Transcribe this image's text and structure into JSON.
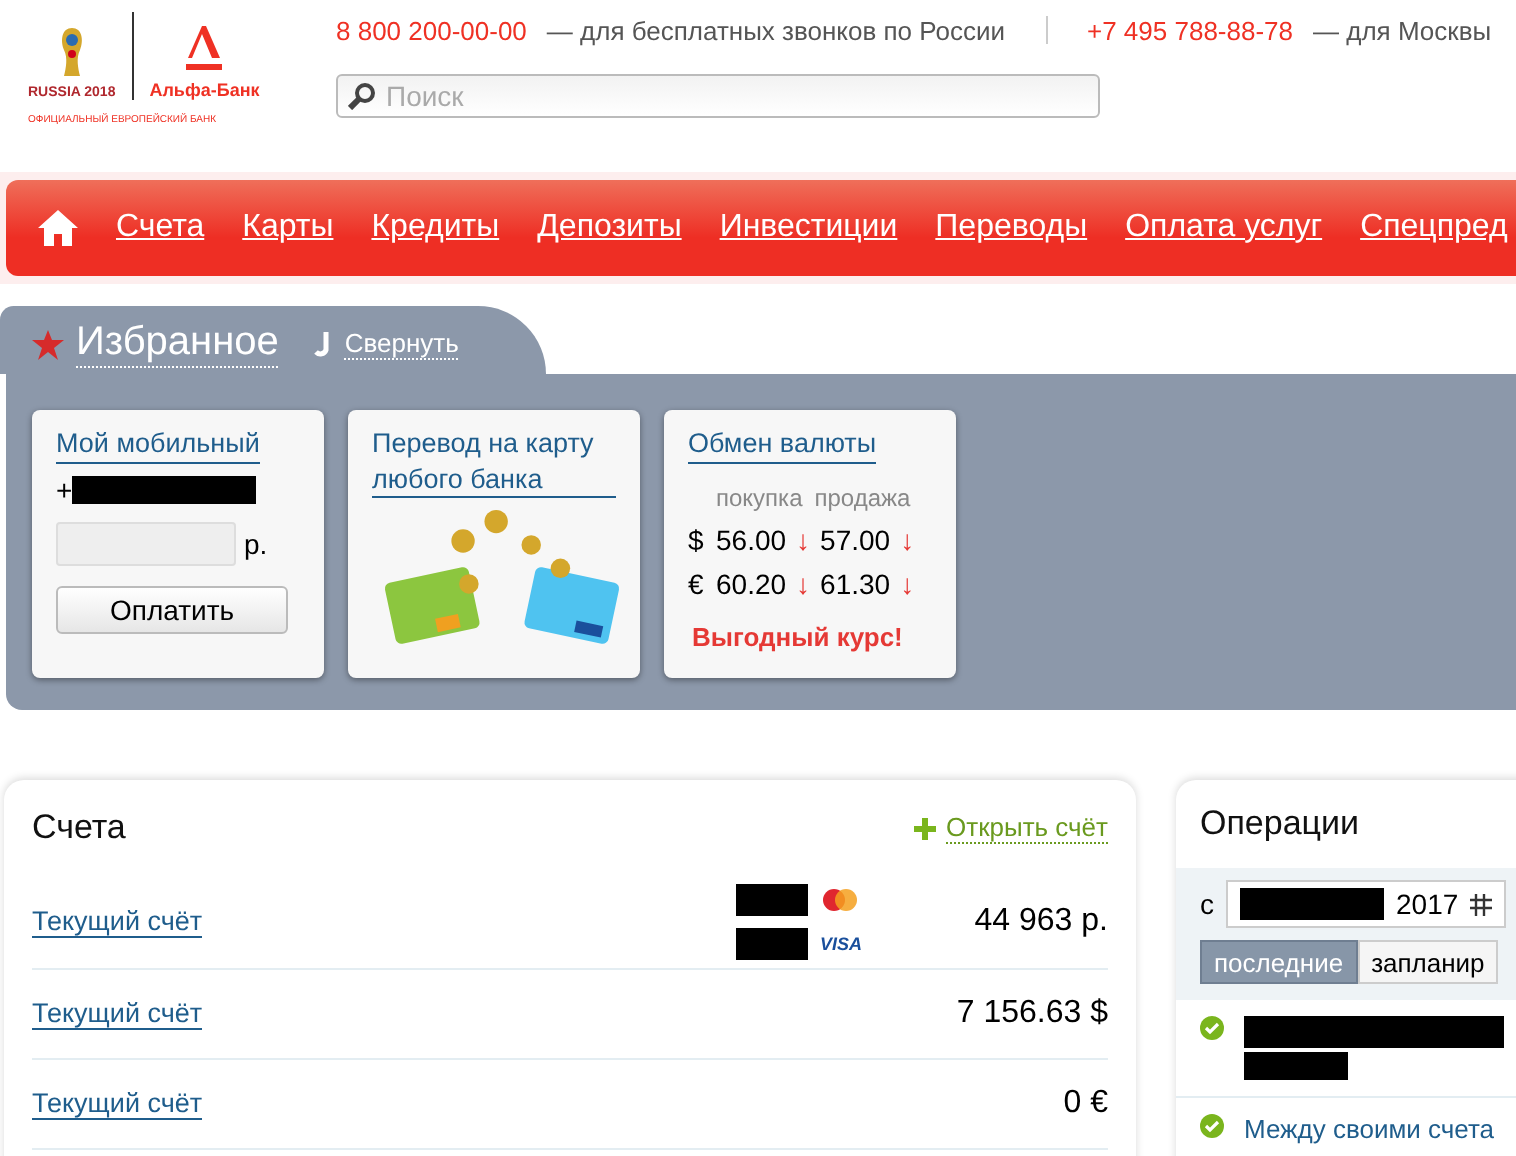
{
  "header": {
    "cup_text": "RUSSIA 2018",
    "bank_name": "Альфа-Банк",
    "tagline": "ОФИЦИАЛЬНЫЙ ЕВРОПЕЙСКИЙ БАНК",
    "phones": [
      {
        "number": "8 800 200-00-00",
        "note": "— для бесплатных звонков по России"
      },
      {
        "number": "+7 495 788-88-78",
        "note": "— для Москвы"
      }
    ],
    "search": {
      "placeholder": "Поиск"
    }
  },
  "nav": {
    "items": [
      "Счета",
      "Карты",
      "Кредиты",
      "Депозиты",
      "Инвестиции",
      "Переводы",
      "Оплата услуг",
      "Спецпред"
    ]
  },
  "favorites": {
    "title": "Избранное",
    "collapse": "Свернуть",
    "cards": [
      {
        "kind": "mobile",
        "title": "Мой мобильный",
        "phone_prefix": "+",
        "currency": "р.",
        "button": "Оплатить"
      },
      {
        "kind": "transfer",
        "title": "Перевод на карту любого банка"
      },
      {
        "kind": "exchange",
        "title": "Обмен валюты",
        "buy": "покупка",
        "sell": "продажа",
        "rates": [
          {
            "symbol": "$",
            "buy": "56.00",
            "buy_arrow": "↓",
            "sell": "57.00",
            "sell_arrow": "↓"
          },
          {
            "symbol": "€",
            "buy": "60.20",
            "buy_arrow": "↓",
            "sell": "61.30",
            "sell_arrow": "↓"
          }
        ],
        "promo": "Выгодный курс!"
      }
    ]
  },
  "accounts": {
    "title": "Счета",
    "open_link": "Открыть счёт",
    "rows": [
      {
        "name": "Текущий счёт",
        "amount": "44 963 р.",
        "cards": [
          {
            "kind": "mastercard"
          },
          {
            "kind": "visa",
            "label": "VISA"
          }
        ]
      },
      {
        "name": "Текущий счёт",
        "amount": "7 156.63 $",
        "cards": []
      },
      {
        "name": "Текущий счёт",
        "amount": "0 €",
        "cards": []
      }
    ]
  },
  "operations": {
    "title": "Операции",
    "date_prefix": "с",
    "date_year": "2017",
    "tabs": [
      {
        "label": "последние",
        "selected": true
      },
      {
        "label": "запланир",
        "selected": false
      }
    ],
    "items": [
      {
        "done": true
      },
      {
        "done": true,
        "text": "Между своими счета"
      }
    ]
  }
}
